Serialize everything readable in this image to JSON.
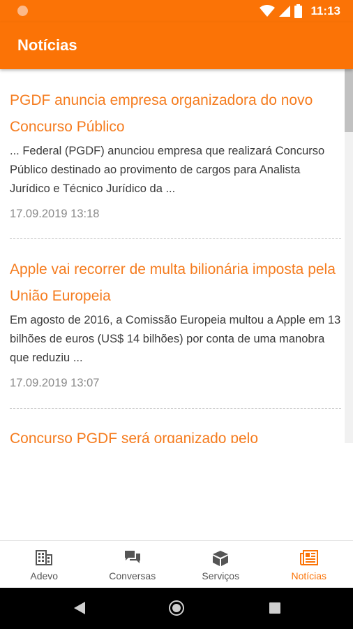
{
  "status_bar": {
    "time": "11:13"
  },
  "app_bar": {
    "title": "Notícias"
  },
  "news": [
    {
      "title": "PGDF anuncia empresa organizadora do novo Concurso Público",
      "excerpt": "... Federal (PGDF) anunciou empresa que realizará Concurso Público destinado ao provimento de cargos para Analista Jurídico e Técnico Jurídico da ...",
      "date": "17.09.2019 13:18"
    },
    {
      "title": "Apple vai recorrer de multa bilionária imposta pela União Europeia",
      "excerpt": "Em agosto de 2016, a Comissão Europeia multou a Apple em 13 bilhões de euros (US$ 14 bilhões) por conta de uma manobra que reduziu ...",
      "date": "17.09.2019 13:07"
    },
    {
      "title": "Concurso PGDF será organizado pelo",
      "excerpt": "",
      "date": ""
    }
  ],
  "bottom_nav": [
    {
      "label": "Adevo",
      "icon": "building-icon"
    },
    {
      "label": "Conversas",
      "icon": "chat-icon"
    },
    {
      "label": "Serviços",
      "icon": "box-icon"
    },
    {
      "label": "Notícias",
      "icon": "newspaper-icon"
    }
  ],
  "colors": {
    "primary": "#fb7306",
    "headline": "#f57c1f",
    "active_tab": "#fb7306"
  }
}
